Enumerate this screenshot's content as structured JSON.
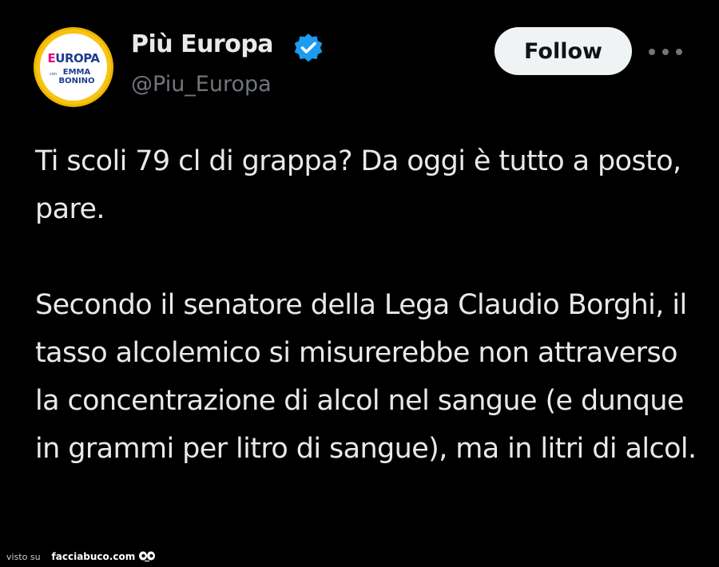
{
  "account": {
    "display_name": "Più Europa",
    "handle": "@Piu_Europa",
    "verified": true,
    "avatar": {
      "logo_top_prefix": "E",
      "logo_top_rest": "UROPA",
      "logo_small": "con",
      "logo_bottom_1": "EMMA",
      "logo_bottom_2": "BONINO"
    }
  },
  "actions": {
    "follow_label": "Follow",
    "more_icon": "more-horizontal-icon"
  },
  "tweet": {
    "paragraph_1": "Ti scoli 79 cl di grappa? Da oggi è tutto a posto, pare.",
    "paragraph_2": "Secondo il senatore della Lega Claudio Borghi, il tasso alcolemico si misurerebbe non attraverso la concentrazione di alcol nel sangue (e dunque in grammi per litro di sangue), ma in litri di alcol."
  },
  "watermark": {
    "prefix": "visto su",
    "site": "facciabuco.com"
  },
  "colors": {
    "background": "#000000",
    "primary_text": "#e7e9ea",
    "secondary_text": "#71767b",
    "verified_badge": "#1d9bf0",
    "follow_button_bg": "#eff3f4",
    "avatar_ring": "#f6c514"
  }
}
